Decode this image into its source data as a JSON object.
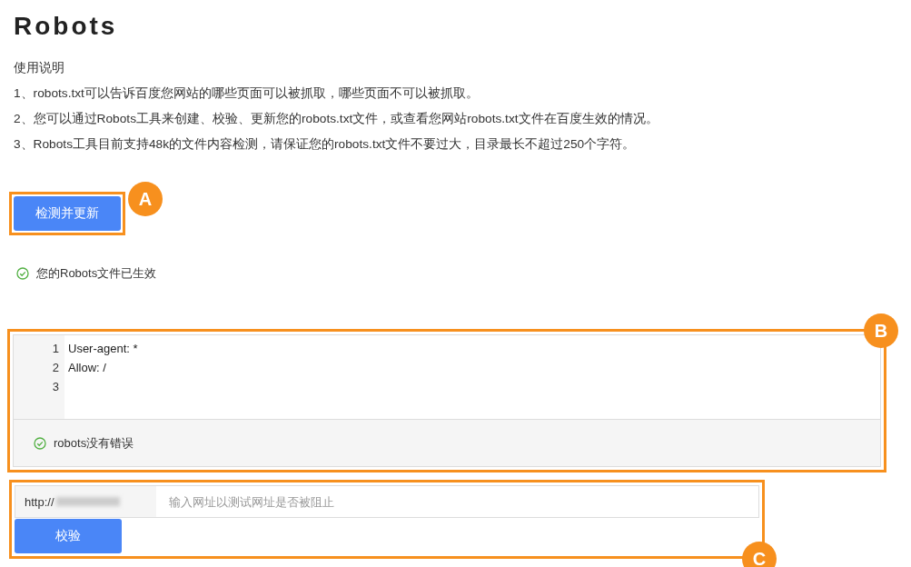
{
  "title": "Robots",
  "instructions": {
    "heading": "使用说明",
    "lines": [
      "1、robots.txt可以告诉百度您网站的哪些页面可以被抓取，哪些页面不可以被抓取。",
      "2、您可以通过Robots工具来创建、校验、更新您的robots.txt文件，或查看您网站robots.txt文件在百度生效的情况。",
      "3、Robots工具目前支持48k的文件内容检测，请保证您的robots.txt文件不要过大，目录最长不超过250个字符。"
    ]
  },
  "update_button": {
    "label": "检测并更新",
    "callout": "A"
  },
  "status": {
    "text": "您的Robots文件已生效",
    "ok": true
  },
  "editor": {
    "callout": "B",
    "lines": [
      {
        "number": "1",
        "text": "User-agent: *"
      },
      {
        "number": "2",
        "text": "Allow: /"
      },
      {
        "number": "3"
      }
    ],
    "result": {
      "text": "robots没有错误",
      "ok": true
    }
  },
  "url_test": {
    "callout": "C",
    "prefix": "http://",
    "domain_redacted": true,
    "placeholder": "输入网址以测试网址是否被阻止",
    "button": "校验"
  }
}
